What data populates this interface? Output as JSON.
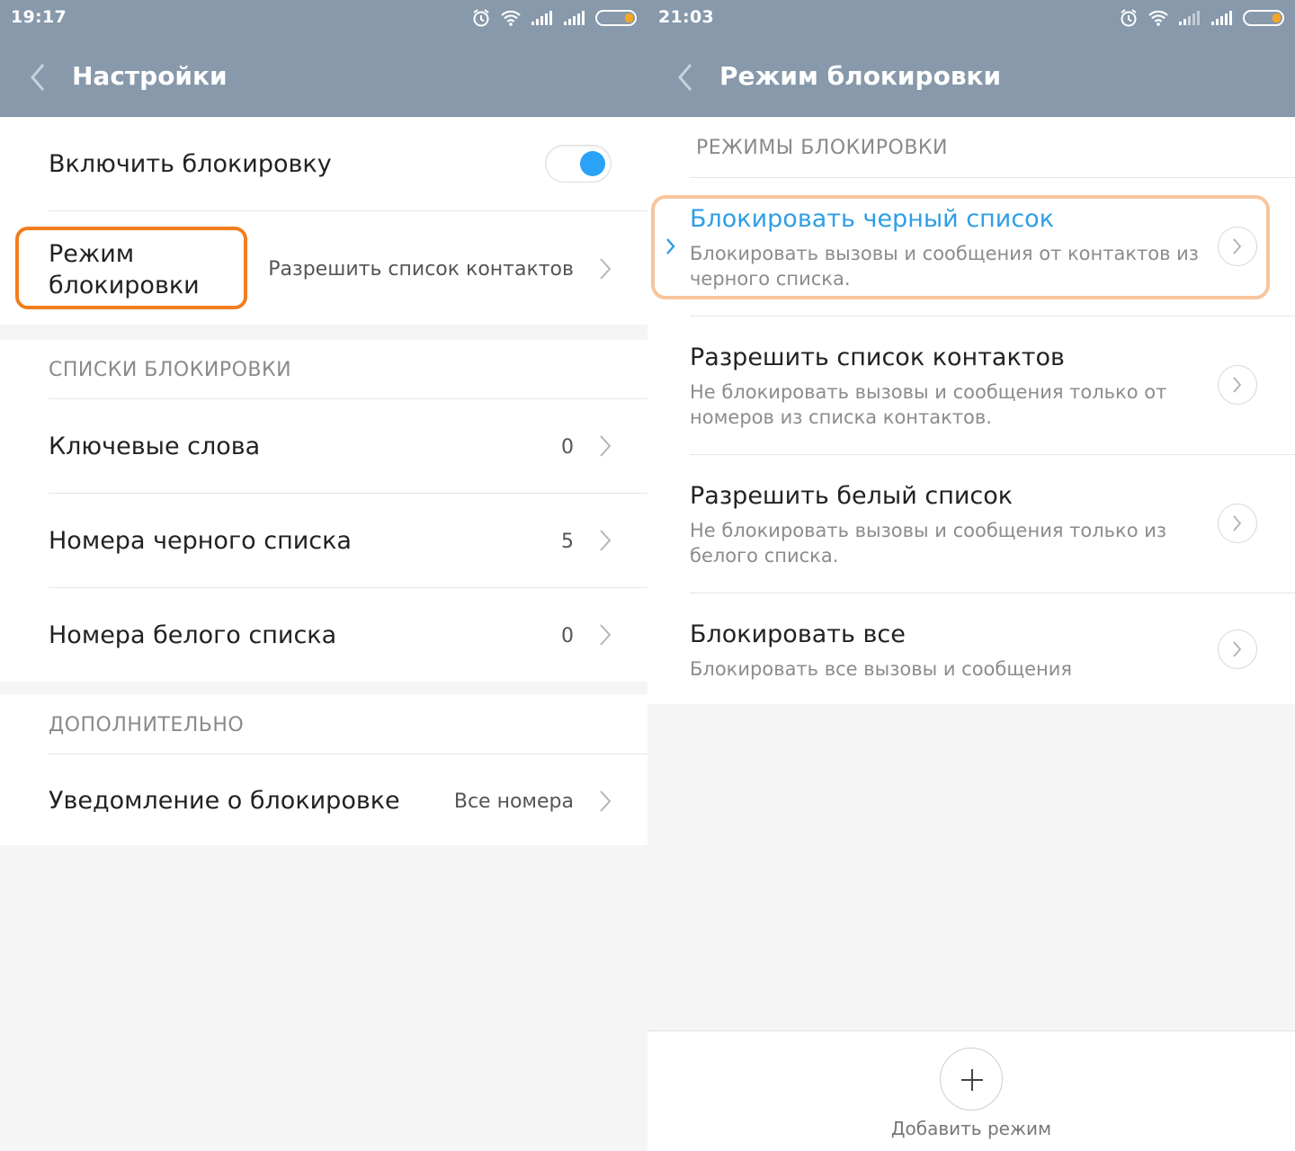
{
  "left": {
    "status_time": "19:17",
    "title": "Настройки",
    "enable_block_label": "Включить блокировку",
    "block_mode_label": "Режим блокировки",
    "block_mode_line1": "Режим",
    "block_mode_line2": "блокировки",
    "block_mode_value": "Разрешить список контактов",
    "section_lists": "СПИСКИ БЛОКИРОВКИ",
    "keywords_label": "Ключевые слова",
    "keywords_count": "0",
    "blacklist_label": "Номера черного списка",
    "blacklist_count": "5",
    "whitelist_label": "Номера белого списка",
    "whitelist_count": "0",
    "section_extra": "ДОПОЛНИТЕЛЬНО",
    "notify_label": "Уведомление о блокировке",
    "notify_value": "Все номера",
    "toggle_on": true,
    "toggle_color": "#2aa2f5",
    "highlight_color": "#f27d1e"
  },
  "right": {
    "status_time": "21:03",
    "title": "Режим блокировки",
    "section_modes": "РЕЖИМЫ БЛОКИРОВКИ",
    "modes": [
      {
        "title": "Блокировать черный список",
        "desc": "Блокировать вызовы и сообщения от контактов из черного списка.",
        "selected": true
      },
      {
        "title": "Разрешить список контактов",
        "desc": "Не блокировать вызовы и сообщения только от номеров из списка контактов.",
        "selected": false
      },
      {
        "title": "Разрешить белый список",
        "desc": "Не блокировать вызовы и сообщения только из белого списка.",
        "selected": false
      },
      {
        "title": "Блокировать все",
        "desc": "Блокировать все вызовы и сообщения",
        "selected": false
      }
    ],
    "add_mode_label": "Добавить режим",
    "selected_color": "#2e9ee6",
    "highlight_color": "#f8c59c"
  },
  "colors": {
    "appbar": "#8799ab",
    "battery_fill": "#f5a623"
  },
  "icons": [
    "back-arrow-icon",
    "alarm-icon",
    "wifi-icon",
    "signal-icon",
    "battery-icon",
    "chevron-right-icon",
    "plus-icon",
    "check-chevron-icon"
  ]
}
